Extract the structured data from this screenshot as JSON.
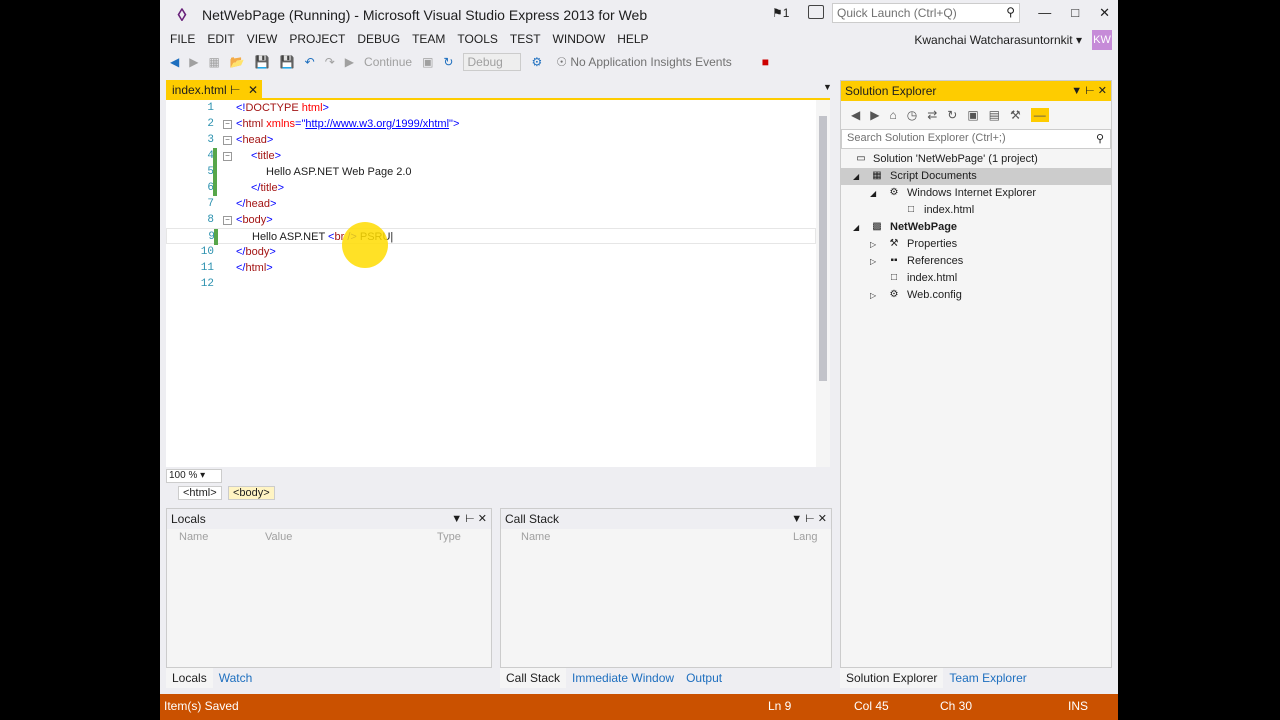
{
  "window": {
    "title": "NetWebPage (Running) - Microsoft Visual Studio Express 2013 for Web",
    "notification_count": "1",
    "quick_launch_placeholder": "Quick Launch (Ctrl+Q)",
    "user_name": "Kwanchai Watcharasuntornkit",
    "user_initials": "KW"
  },
  "menu": [
    "FILE",
    "EDIT",
    "VIEW",
    "PROJECT",
    "DEBUG",
    "TEAM",
    "TOOLS",
    "TEST",
    "WINDOW",
    "HELP"
  ],
  "toolbar": {
    "continue_label": "Continue",
    "config_value": "Debug",
    "insights_label": "No Application Insights Events"
  },
  "editor": {
    "tab_label": "index.html",
    "zoom": "100 %",
    "lines": [
      {
        "n": "1",
        "text": "<!DOCTYPE html>"
      },
      {
        "n": "2",
        "text": "<html xmlns=\"http://www.w3.org/1999/xhtml\">"
      },
      {
        "n": "3",
        "text": "<head>"
      },
      {
        "n": "4",
        "text": "<title>"
      },
      {
        "n": "5",
        "text": "Hello ASP.NET Web Page 2.0"
      },
      {
        "n": "6",
        "text": "</title>"
      },
      {
        "n": "7",
        "text": "</head>"
      },
      {
        "n": "8",
        "text": "<body>"
      },
      {
        "n": "9",
        "text": "Hello ASP.NET <br /> PSRU"
      },
      {
        "n": "10",
        "text": "</body>"
      },
      {
        "n": "11",
        "text": "</html>"
      },
      {
        "n": "12",
        "text": ""
      }
    ],
    "breadcrumbs": [
      "<html>",
      "<body>"
    ]
  },
  "locals_panel": {
    "title": "Locals",
    "columns": [
      "Name",
      "Value",
      "Type"
    ],
    "tabs": [
      "Locals",
      "Watch"
    ]
  },
  "callstack_panel": {
    "title": "Call Stack",
    "columns": [
      "Name",
      "Lang"
    ],
    "tabs": [
      "Call Stack",
      "Immediate Window",
      "Output"
    ]
  },
  "solution_explorer": {
    "title": "Solution Explorer",
    "search_placeholder": "Search Solution Explorer (Ctrl+;)",
    "nodes": [
      {
        "label": "Solution 'NetWebPage' (1 project)",
        "icon": "solution-icon"
      },
      {
        "label": "Script Documents",
        "icon": "script-icon"
      },
      {
        "label": "Windows Internet Explorer",
        "icon": "browser-icon"
      },
      {
        "label": "index.html",
        "icon": "file-icon"
      },
      {
        "label": "NetWebPage",
        "icon": "project-icon"
      },
      {
        "label": "Properties",
        "icon": "wrench-icon"
      },
      {
        "label": "References",
        "icon": "references-icon"
      },
      {
        "label": "index.html",
        "icon": "file-icon"
      },
      {
        "label": "Web.config",
        "icon": "config-icon"
      }
    ],
    "tabs": [
      "Solution Explorer",
      "Team Explorer"
    ]
  },
  "status": {
    "message": "Item(s) Saved",
    "line": "Ln 9",
    "col": "Col 45",
    "ch": "Ch 30",
    "mode": "INS"
  },
  "colors": {
    "accent": "#fecc00",
    "status": "#ca5100",
    "vs_purple": "#68217a"
  }
}
